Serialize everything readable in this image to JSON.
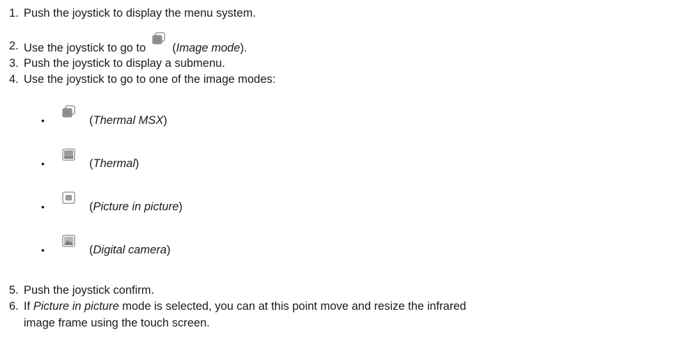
{
  "steps": [
    {
      "num": "1.",
      "text": "Push the joystick to display the menu system."
    },
    {
      "num": "2.",
      "pre": "Use the joystick to go to",
      "open": "(",
      "em": "Image mode",
      "close": ")."
    },
    {
      "num": "3.",
      "text": "Push the joystick to display a submenu."
    },
    {
      "num": "4.",
      "text": "Use the joystick to go to one of the image modes:"
    },
    {
      "num": "5.",
      "text": "Push the joystick confirm."
    },
    {
      "num": "6.",
      "pre": "If",
      "em": "Picture in picture",
      "post": "mode is selected, you can at this point move and resize the infrared",
      "line2": "image frame using the touch screen."
    }
  ],
  "modes": [
    {
      "icon": "thermal-msx-icon",
      "open": "(",
      "em": "Thermal MSX",
      "close": ")"
    },
    {
      "icon": "thermal-icon",
      "open": "(",
      "em": "Thermal",
      "close": ")"
    },
    {
      "icon": "picture-in-picture-icon",
      "open": "(",
      "em": "Picture in picture",
      "close": ")"
    },
    {
      "icon": "digital-camera-icon",
      "open": "(",
      "em": "Digital camera",
      "close": ")"
    }
  ],
  "bullet": "•",
  "colors": {
    "text": "#1a1a1a",
    "icon_fill": "#9a9a9a",
    "icon_stroke": "#7a7a7a"
  }
}
